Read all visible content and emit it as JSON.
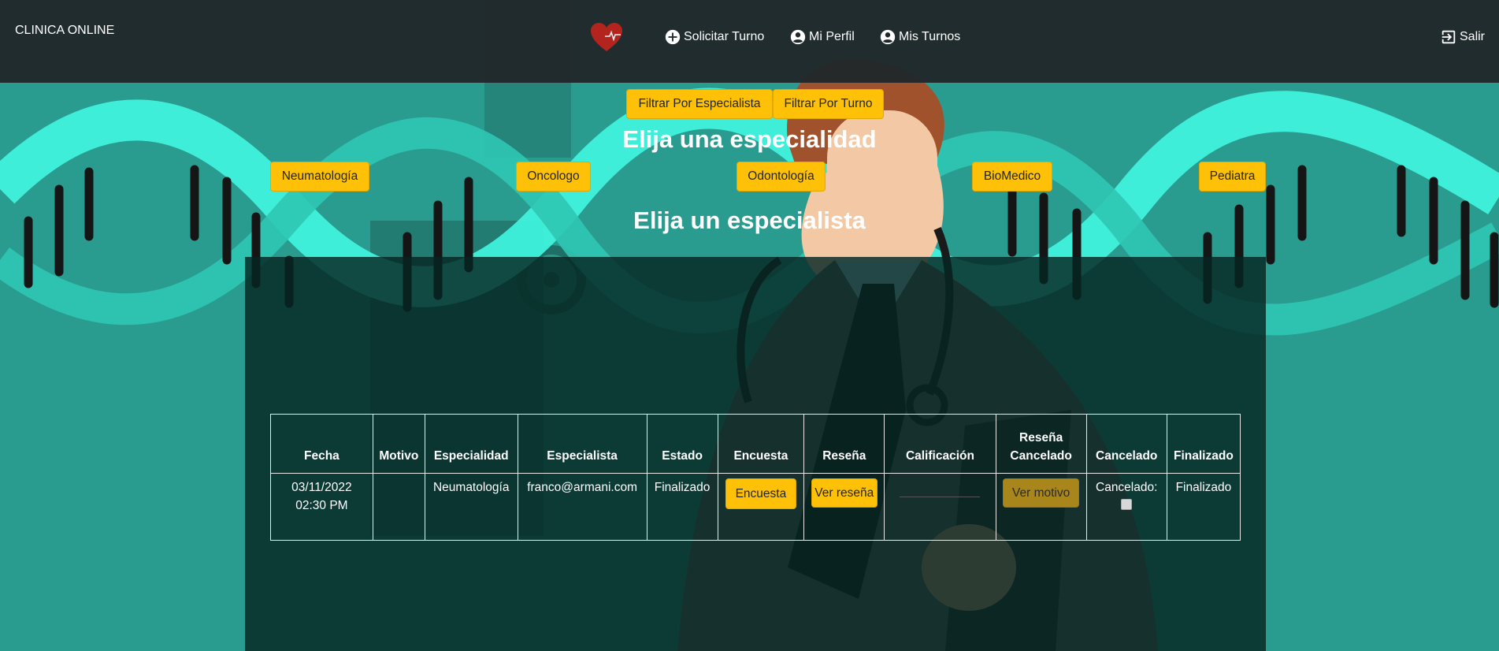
{
  "app": {
    "brand": "CLINICA ONLINE"
  },
  "nav": {
    "items": [
      {
        "label": "Solicitar Turno",
        "icon": "plus-circle-icon"
      },
      {
        "label": "Mi Perfil",
        "icon": "account-circle-icon"
      },
      {
        "label": "Mis Turnos",
        "icon": "account-circle-icon"
      }
    ],
    "logout": {
      "label": "Salir",
      "icon": "exit-icon"
    }
  },
  "filters": {
    "by_specialist": "Filtrar Por Especialista",
    "by_turno": "Filtrar Por Turno"
  },
  "specialty_section": {
    "title": "Elija una especialidad",
    "specialties": [
      "Neumatología",
      "Oncologo",
      "Odontología",
      "BioMedico",
      "Pediatra"
    ]
  },
  "specialist_section": {
    "title": "Elija un especialista"
  },
  "table": {
    "headers": {
      "fecha": "Fecha",
      "motivo": "Motivo",
      "especialidad": "Especialidad",
      "especialista": "Especialista",
      "estado": "Estado",
      "encuesta": "Encuesta",
      "resena": "Reseña",
      "calificacion": "Calificación",
      "resena_cancelado": "Reseña Cancelado",
      "cancelado": "Cancelado",
      "finalizado": "Finalizado"
    },
    "rows": [
      {
        "fecha": "03/11/2022",
        "hora": "02:30 PM",
        "motivo": "",
        "especialidad": "Neumatología",
        "especialista": "franco@armani.com",
        "estado": "Finalizado",
        "encuesta_btn": "Encuesta",
        "resena_btn": "Ver reseña",
        "calificacion": "",
        "resena_cancelado_btn": "Ver motivo",
        "cancelado_label": "Cancelado:",
        "cancelado_checked": false,
        "finalizado": "Finalizado"
      }
    ]
  },
  "colors": {
    "navbar": "#212829",
    "background": "#2a9b8f",
    "accent_button": "#ffc107",
    "dna_helix": "#3ff2dc",
    "panel": "#0a2a27"
  }
}
